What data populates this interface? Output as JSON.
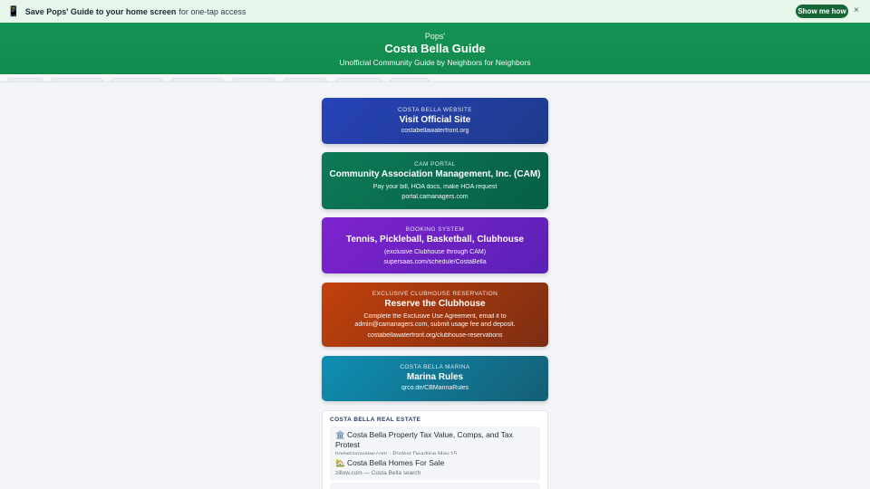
{
  "banner": {
    "phone_icon": "📱",
    "bold": "Save Pops' Guide to your home screen",
    "rest": "for one-tap access",
    "button": "Show me how",
    "close": "×"
  },
  "header": {
    "kicker": "Pops'",
    "title": "Costa Bella Guide",
    "subtitle": "Unofficial Community Guide by Neighbors for Neighbors"
  },
  "cards": [
    {
      "label": "COSTA BELLA WEBSITE",
      "name": "Visit Official Site",
      "url": "costabellawaterfront.org"
    },
    {
      "label": "CAM PORTAL",
      "name": "Community Association Management, Inc. (CAM)",
      "desc": "Pay your bill, HOA docs, make HOA request",
      "url": "portal.camanagers.com"
    },
    {
      "label": "BOOKING SYSTEM",
      "name": "Tennis, Pickleball, Basketball, Clubhouse",
      "desc": "(exclusive Clubhouse through CAM)",
      "url": "supersaas.com/schedule/CostaBella"
    },
    {
      "label": "EXCLUSIVE CLUBHOUSE RESERVATION",
      "name": "Reserve the Clubhouse",
      "desc": "Complete the Exclusive Use Agreement, email it to admin@camanagers.com, submit usage fee and deposit.",
      "url": "costabellawaterfront.org/clubhouse-reservations"
    },
    {
      "label": "COSTA BELLA MARINA",
      "name": "Marina Rules",
      "url": "qrco.de/CBMarinaRules"
    }
  ],
  "real_estate": {
    "title": "COSTA BELLA REAL ESTATE",
    "items": [
      {
        "icon": "🏛️",
        "title": "Costa Bella Property Tax Value, Comps, and Tax Protest",
        "meta": "hometaxreview.com · Protest Deadline May 15"
      },
      {
        "icon": "🏡",
        "title": "Costa Bella Homes For Sale",
        "meta": "zillow.com — Costa Bella search"
      }
    ]
  }
}
